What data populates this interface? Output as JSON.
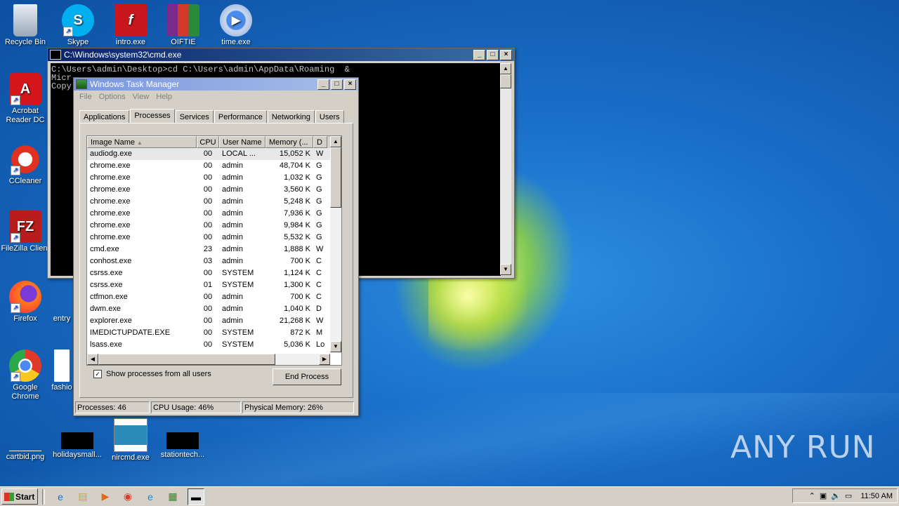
{
  "desktop": {
    "icons": [
      {
        "label": "Recycle Bin"
      },
      {
        "label": "Skype"
      },
      {
        "label": "intro.exe"
      },
      {
        "label": "OIFTIE"
      },
      {
        "label": "time.exe"
      },
      {
        "label": "Acrobat Reader DC"
      },
      {
        "label": "CCleaner"
      },
      {
        "label": "FileZilla Client"
      },
      {
        "label": "Firefox"
      },
      {
        "label": "entry"
      },
      {
        "label": "Google Chrome"
      },
      {
        "label": "fashio"
      },
      {
        "label": "cartbid.png"
      },
      {
        "label": "holidaysmall..."
      },
      {
        "label": "nircmd.exe"
      },
      {
        "label": "stationtech..."
      }
    ],
    "watermark": "ANY RUN"
  },
  "cmd": {
    "title": "C:\\Windows\\system32\\cmd.exe",
    "lines": [
      "C:\\Users\\admin\\Desktop>cd C:\\Users\\admin\\AppData\\Roaming  &",
      "Micr",
      "Copy                                                     d."
    ]
  },
  "taskmanager": {
    "title": "Windows Task Manager",
    "menu": [
      "File",
      "Options",
      "View",
      "Help"
    ],
    "tabs": [
      "Applications",
      "Processes",
      "Services",
      "Performance",
      "Networking",
      "Users"
    ],
    "active_tab": "Processes",
    "columns": [
      "Image Name",
      "CPU",
      "User Name",
      "Memory (...",
      "D"
    ],
    "rows": [
      [
        "audiodg.exe",
        "00",
        "LOCAL ...",
        "15,052 K",
        "W"
      ],
      [
        "chrome.exe",
        "00",
        "admin",
        "48,704 K",
        "G"
      ],
      [
        "chrome.exe",
        "00",
        "admin",
        "1,032 K",
        "G"
      ],
      [
        "chrome.exe",
        "00",
        "admin",
        "3,560 K",
        "G"
      ],
      [
        "chrome.exe",
        "00",
        "admin",
        "5,248 K",
        "G"
      ],
      [
        "chrome.exe",
        "00",
        "admin",
        "7,936 K",
        "G"
      ],
      [
        "chrome.exe",
        "00",
        "admin",
        "9,984 K",
        "G"
      ],
      [
        "chrome.exe",
        "00",
        "admin",
        "5,532 K",
        "G"
      ],
      [
        "cmd.exe",
        "23",
        "admin",
        "1,888 K",
        "W"
      ],
      [
        "conhost.exe",
        "03",
        "admin",
        "700 K",
        "C"
      ],
      [
        "csrss.exe",
        "00",
        "SYSTEM",
        "1,124 K",
        "C"
      ],
      [
        "csrss.exe",
        "01",
        "SYSTEM",
        "1,300 K",
        "C"
      ],
      [
        "ctfmon.exe",
        "00",
        "admin",
        "700 K",
        "C"
      ],
      [
        "dwm.exe",
        "00",
        "admin",
        "1,040 K",
        "D"
      ],
      [
        "explorer.exe",
        "00",
        "admin",
        "21,268 K",
        "W"
      ],
      [
        "IMEDICTUPDATE.EXE",
        "00",
        "SYSTEM",
        "872 K",
        "M"
      ],
      [
        "lsass.exe",
        "00",
        "SYSTEM",
        "5,036 K",
        "Lo"
      ]
    ],
    "show_all_label": "Show processes from all users",
    "show_all_checked": true,
    "end_process_label": "End Process",
    "status": {
      "processes": "Processes: 46",
      "cpu": "CPU Usage: 46%",
      "memory": "Physical Memory: 26%"
    }
  },
  "taskbar": {
    "start_label": "Start",
    "clock": "11:50 AM"
  }
}
